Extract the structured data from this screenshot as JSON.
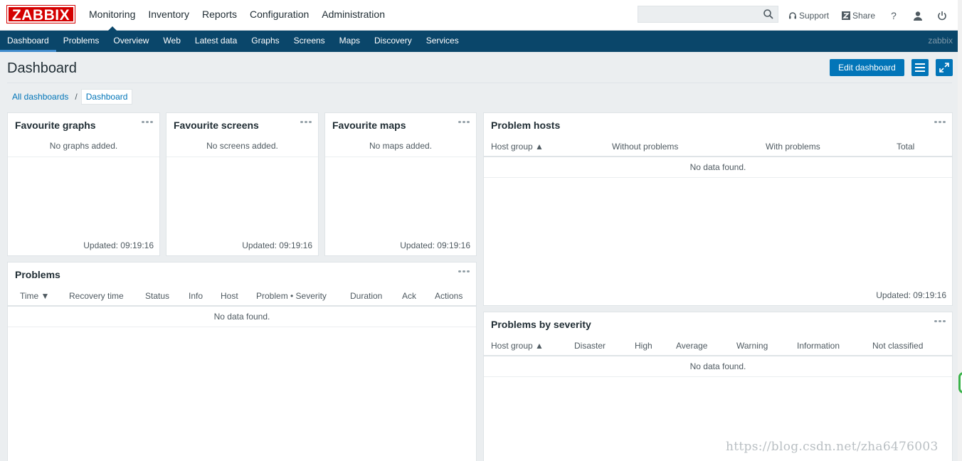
{
  "logo": "ZABBIX",
  "main_menu": [
    "Monitoring",
    "Inventory",
    "Reports",
    "Configuration",
    "Administration"
  ],
  "search": {
    "value": "",
    "placeholder": ""
  },
  "top_right": {
    "support": "Support",
    "share": "Share",
    "help": "?"
  },
  "sub_nav": [
    "Dashboard",
    "Problems",
    "Overview",
    "Web",
    "Latest data",
    "Graphs",
    "Screens",
    "Maps",
    "Discovery",
    "Services"
  ],
  "user": "zabbix",
  "page_title": "Dashboard",
  "edit_dashboard": "Edit dashboard",
  "breadcrumb": {
    "all": "All dashboards",
    "sep": "/",
    "current": "Dashboard"
  },
  "widgets": {
    "fav_graphs": {
      "title": "Favourite graphs",
      "empty": "No graphs added.",
      "updated": "Updated: 09:19:16"
    },
    "fav_screens": {
      "title": "Favourite screens",
      "empty": "No screens added.",
      "updated": "Updated: 09:19:16"
    },
    "fav_maps": {
      "title": "Favourite maps",
      "empty": "No maps added.",
      "updated": "Updated: 09:19:16"
    },
    "problem_hosts": {
      "title": "Problem hosts",
      "columns": [
        "Host group ▲",
        "Without problems",
        "With problems",
        "Total"
      ],
      "nodata": "No data found.",
      "updated": "Updated: 09:19:16"
    },
    "problems": {
      "title": "Problems",
      "columns": [
        "Time ▼",
        "Recovery time",
        "Status",
        "Info",
        "Host",
        "Problem • Severity",
        "Duration",
        "Ack",
        "Actions"
      ],
      "nodata": "No data found."
    },
    "problems_by_severity": {
      "title": "Problems by severity",
      "columns": [
        "Host group ▲",
        "Disaster",
        "High",
        "Average",
        "Warning",
        "Information",
        "Not classified"
      ],
      "nodata": "No data found."
    }
  },
  "watermark": "https://blog.csdn.net/zha6476003",
  "colors": {
    "brand_red": "#d40000",
    "nav_blue": "#0a466a",
    "button_blue": "#0275b8",
    "link_blue": "#0275b8"
  }
}
